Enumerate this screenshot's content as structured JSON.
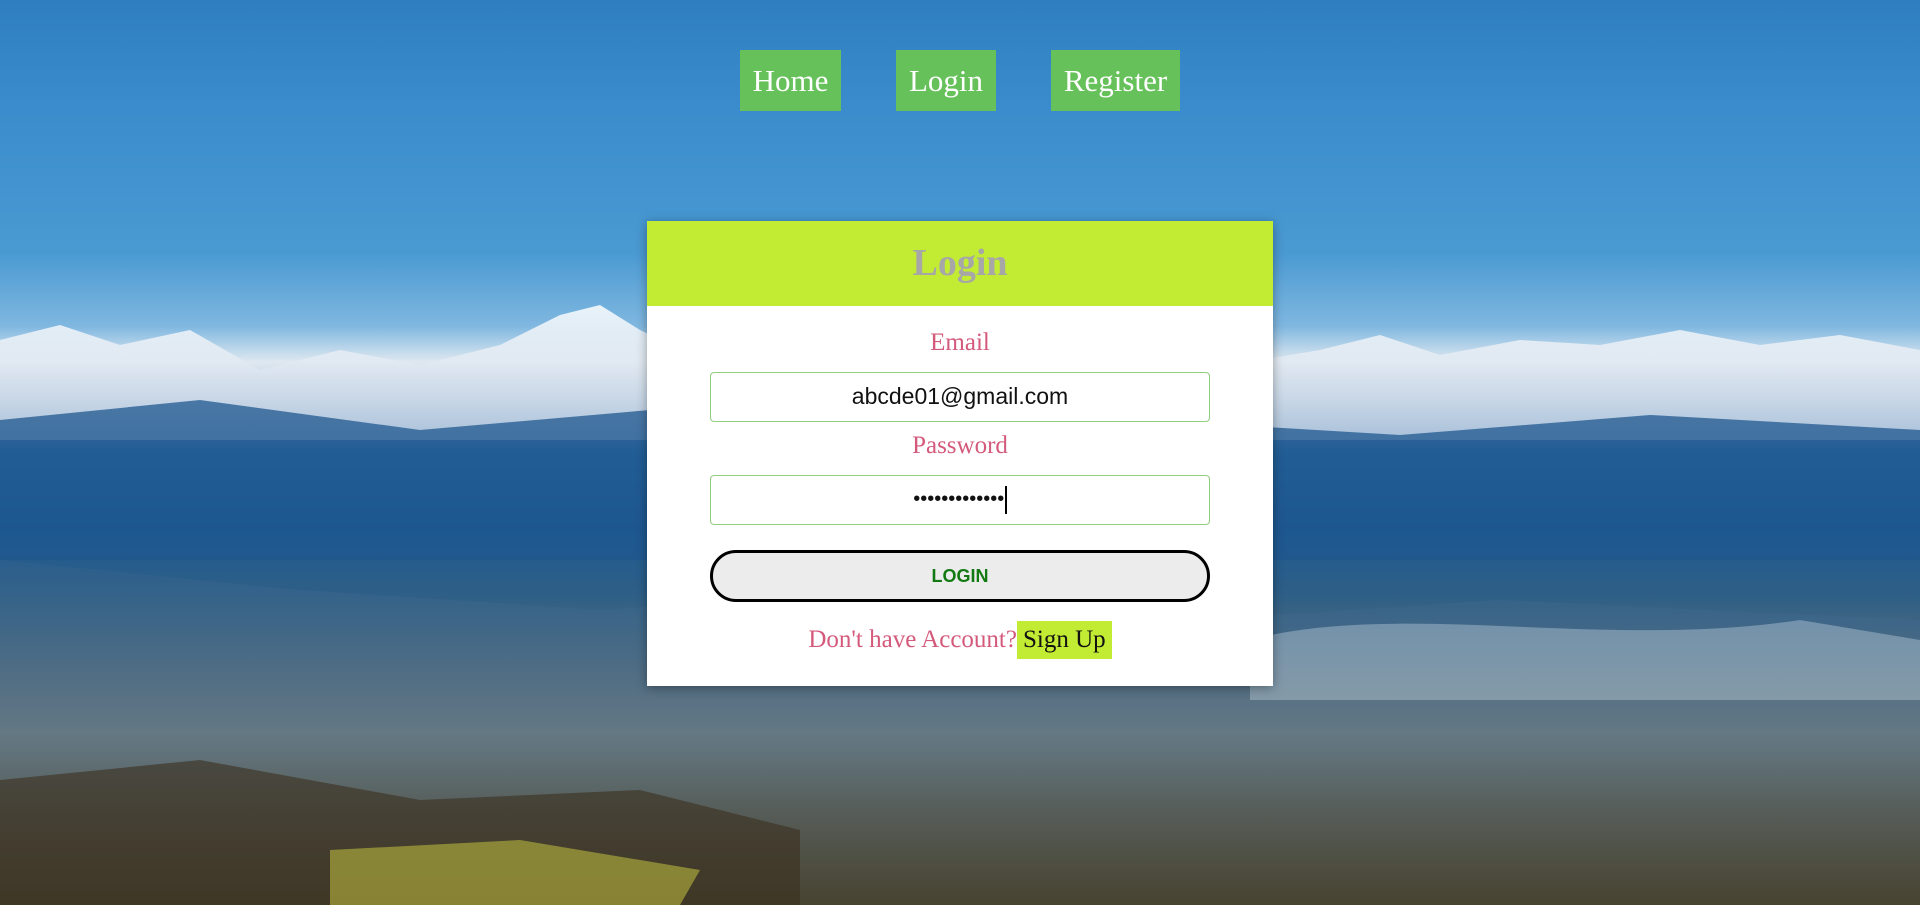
{
  "nav": {
    "home_label": "Home",
    "login_label": "Login",
    "register_label": "Register"
  },
  "login_card": {
    "title": "Login",
    "email_label": "Email",
    "email_value": "abcde01@gmail.com",
    "password_label": "Password",
    "password_value_masked": "•••••••••••••",
    "login_button_label": "LOGIN",
    "signup_prompt": "Don't have Account?",
    "signup_link_label": "Sign Up"
  },
  "colors": {
    "nav_button_bg": "#66c15a",
    "card_header_bg": "#c2eb33",
    "label_text": "#d45a7c",
    "login_button_text": "#137a13"
  }
}
